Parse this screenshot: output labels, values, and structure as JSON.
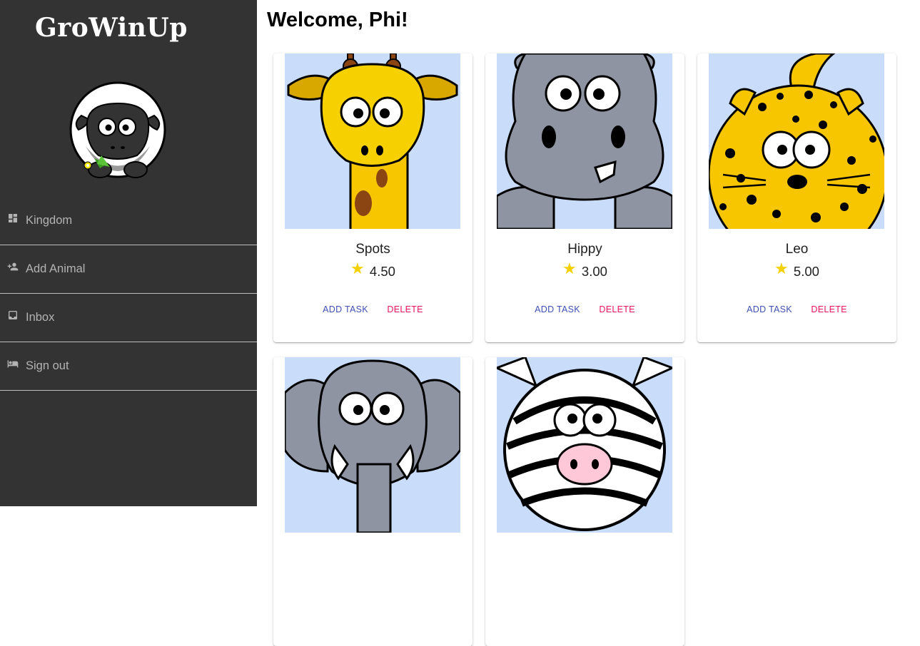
{
  "app": {
    "brand": "GroWinUp"
  },
  "sidebar": {
    "items": [
      {
        "label": "Kingdom",
        "icon": "dashboard-icon"
      },
      {
        "label": "Add Animal",
        "icon": "person-add-icon"
      },
      {
        "label": "Inbox",
        "icon": "inbox-icon"
      },
      {
        "label": "Sign out",
        "icon": "bed-icon"
      }
    ]
  },
  "main": {
    "greeting": "Welcome, Phi!",
    "animals": [
      {
        "name": "Spots",
        "rating": "4.50",
        "image": "giraffe"
      },
      {
        "name": "Hippy",
        "rating": "3.00",
        "image": "hippo"
      },
      {
        "name": "Leo",
        "rating": "5.00",
        "image": "leopard"
      },
      {
        "name": "",
        "rating": "",
        "image": "elephant"
      },
      {
        "name": "",
        "rating": "",
        "image": "zebra"
      }
    ],
    "actions": {
      "add_task": "ADD TASK",
      "delete": "DELETE"
    }
  },
  "colors": {
    "sidebar_bg": "#333333",
    "accent_primary": "#3f51b5",
    "accent_danger": "#e8155e",
    "star": "#f5d000",
    "image_bg": "#c9dcfa"
  }
}
